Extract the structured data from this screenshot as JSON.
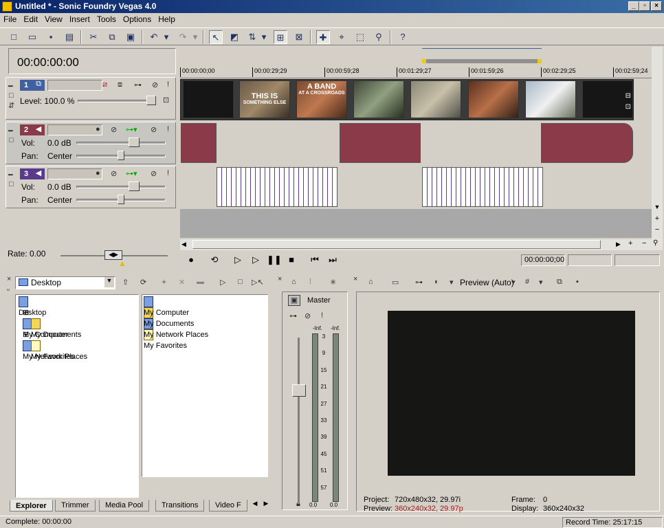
{
  "window": {
    "title": "Untitled * - Sonic Foundry Vegas 4.0"
  },
  "menu": [
    "File",
    "Edit",
    "View",
    "Insert",
    "Tools",
    "Options",
    "Help"
  ],
  "timeline": {
    "current_time": "00:00:00:00",
    "ruler": [
      "00:00:00;00",
      "00:00:29;29",
      "00:00:59;28",
      "00:01:29;27",
      "00:01:59;26",
      "00:02:29;25",
      "00:02:59;24"
    ],
    "rate": "Rate: 0.00",
    "transport_time": "00:00:00;00"
  },
  "tracks": [
    {
      "num": "1",
      "type": "video",
      "level_label": "Level: 100.0 %"
    },
    {
      "num": "2",
      "type": "audio",
      "vol_label": "Vol:",
      "vol_value": "0.0 dB",
      "pan_label": "Pan:",
      "pan_value": "Center"
    },
    {
      "num": "3",
      "type": "audio",
      "vol_label": "Vol:",
      "vol_value": "0.0 dB",
      "pan_label": "Pan:",
      "pan_value": "Center"
    }
  ],
  "thumb_text": {
    "a": "THIS IS",
    "a2": "SOMETHING ELSE",
    "b": "A BAND",
    "b2": "AT A CROSSROADS"
  },
  "explorer": {
    "location": "Desktop",
    "tree": [
      "Desktop",
      "My Computer",
      "My Documents",
      "My Network Places",
      "My Favorites"
    ],
    "files": [
      "My Computer",
      "My Documents",
      "My Network Places",
      "My Favorites"
    ],
    "tabs": [
      "Explorer",
      "Trimmer",
      "Media Pool",
      "Transitions",
      "Video F"
    ]
  },
  "mixer": {
    "master": "Master",
    "peak_left": "-Inf.",
    "peak_right": "-Inf.",
    "scale": [
      "3",
      "9",
      "15",
      "21",
      "27",
      "33",
      "39",
      "45",
      "51",
      "57"
    ],
    "bottom_left": "0.0",
    "bottom_right": "0.0"
  },
  "preview": {
    "mode": "Preview (Auto)",
    "project_label": "Project:",
    "project_value": "720x480x32, 29.97i",
    "preview_label": "Preview:",
    "preview_value": "360x240x32, 29.97p",
    "frame_label": "Frame:",
    "frame_value": "0",
    "display_label": "Display:",
    "display_value": "360x240x32"
  },
  "status": {
    "left": "Complete: 00:00:00",
    "record": "Record Time: 25:17:15"
  },
  "colors": {
    "title_start": "#0a246a",
    "title_end": "#3a6ea5",
    "audio_clip": "#8b3a4a",
    "preview_value": "#a01818"
  }
}
